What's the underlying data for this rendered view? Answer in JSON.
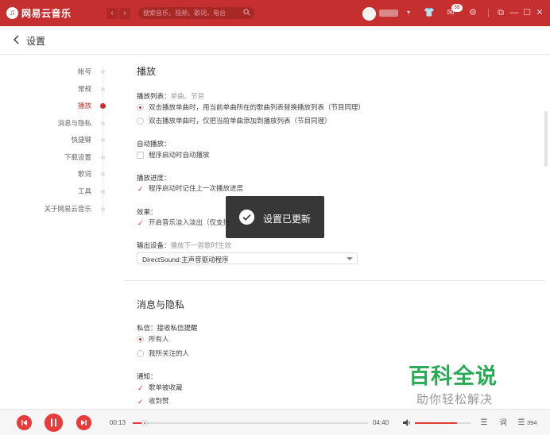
{
  "titlebar": {
    "app_name": "网易云音乐",
    "search_placeholder": "搜索音乐，视频，歌词，电台",
    "message_badge": "38"
  },
  "header": {
    "title": "设置"
  },
  "sidebar": {
    "items": [
      {
        "label": "帐号",
        "active": false
      },
      {
        "label": "常规",
        "active": false
      },
      {
        "label": "播放",
        "active": true
      },
      {
        "label": "消息与隐私",
        "active": false
      },
      {
        "label": "快捷键",
        "active": false
      },
      {
        "label": "下载设置",
        "active": false
      },
      {
        "label": "歌词",
        "active": false
      },
      {
        "label": "工具",
        "active": false
      },
      {
        "label": "关于网易云音乐",
        "active": false
      }
    ]
  },
  "playback": {
    "section_title": "播放",
    "playlist_label": "播放列表：",
    "playlist_hint": "单曲、节目",
    "playlist_options": [
      {
        "label": "双击播放单曲时，用当前单曲所在的歌曲列表替换播放列表（节目同理）",
        "selected": true
      },
      {
        "label": "双击播放单曲时，仅把当前单曲添加到播放列表（节目同理）",
        "selected": false
      }
    ],
    "autoplay_label": "自动播放：",
    "autoplay_option": {
      "label": "程序启动时自动播放",
      "checked": false
    },
    "progress_label": "播放进度：",
    "progress_option": {
      "label": "程序启动时记住上一次播放进度",
      "checked": true
    },
    "effects_label": "效果：",
    "effects_option": {
      "label": "开启音乐淡入淡出（仅支持",
      "checked": true
    },
    "output_label": "输出设备：",
    "output_hint": "播放下一首歌时生效",
    "output_value": "DirectSound:主声音驱动程序"
  },
  "privacy": {
    "section_title": "消息与隐私",
    "dm_label": "私信：",
    "dm_hint": "接收私信提醒",
    "dm_options": [
      {
        "label": "所有人",
        "selected": true
      },
      {
        "label": "我所关注的人",
        "selected": false
      }
    ],
    "notify_label": "通知：",
    "notify_options": [
      {
        "label": "歌单被收藏",
        "checked": true
      },
      {
        "label": "收到赞",
        "checked": true
      }
    ]
  },
  "toast": {
    "text": "设置已更新"
  },
  "watermark": {
    "main": "百科全说",
    "sub": "助你轻松解决"
  },
  "player": {
    "current_time": "00:13",
    "total_time": "04:40",
    "progress_fraction": 0.05,
    "volume_fraction": 0.75,
    "playlist_count": "394"
  },
  "colors": {
    "brand_red": "#c62f2f",
    "player_red": "#e83c3c",
    "watermark_green": "#2aaa55"
  }
}
